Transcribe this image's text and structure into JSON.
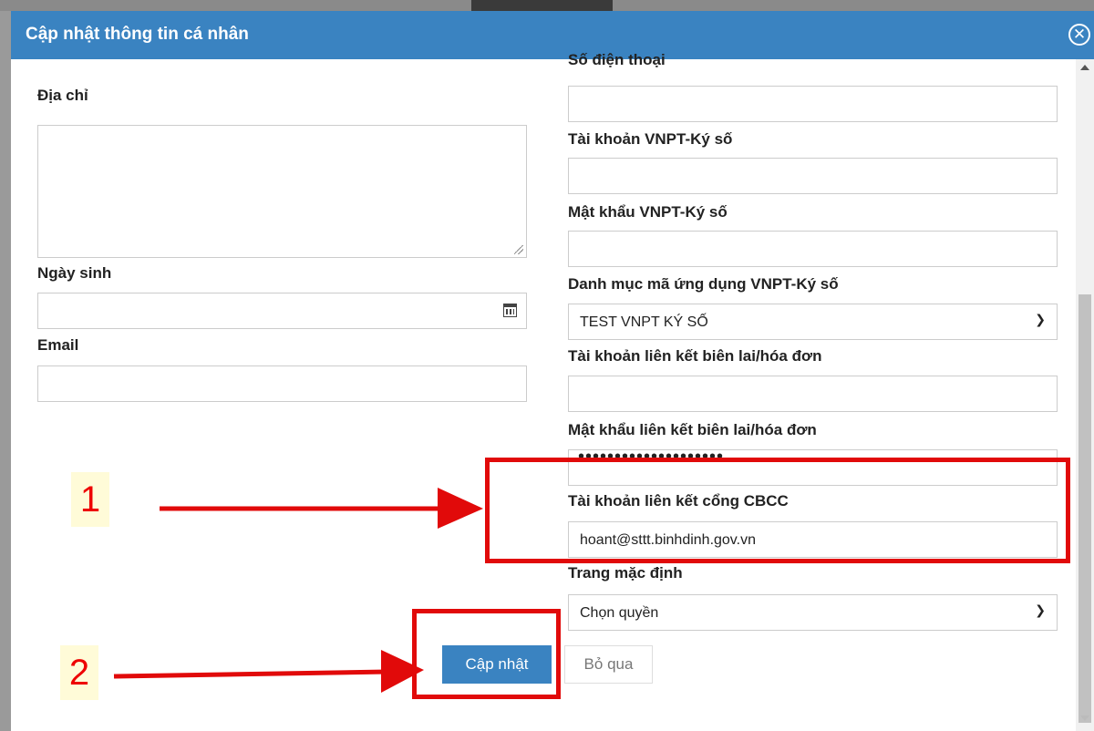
{
  "dialog": {
    "title": "Cập nhật thông tin cá nhân"
  },
  "left": {
    "address_label": "Địa chỉ",
    "birthdate_label": "Ngày sinh",
    "email_label": "Email"
  },
  "right": {
    "phone_label": "Số điện thoại",
    "signing_account_label": "Tài khoản VNPT-Ký số",
    "signing_password_label": "Mật khẩu VNPT-Ký số",
    "app_code_label": "Danh mục mã ứng dụng VNPT-Ký số",
    "app_code_value": "TEST VNPT KÝ SỐ",
    "invoice_account_label": "Tài khoản liên kết biên lai/hóa đơn",
    "invoice_password_label": "Mật khẩu liên kết biên lai/hóa đơn",
    "invoice_password_masked": "••••••••••••••••••••",
    "cbcc_account_label": "Tài khoản liên kết cổng CBCC",
    "cbcc_account_value": "hoant@sttt.binhdinh.gov.vn",
    "default_page_label": "Trang mặc định",
    "default_page_value": "Chọn quyền"
  },
  "buttons": {
    "update": "Cập nhật",
    "cancel": "Bỏ qua"
  },
  "annotations": {
    "one": "1",
    "two": "2",
    "color": "#e10a0a"
  },
  "colors": {
    "header": "#3a83c1",
    "primary_button": "#3a83c1"
  }
}
